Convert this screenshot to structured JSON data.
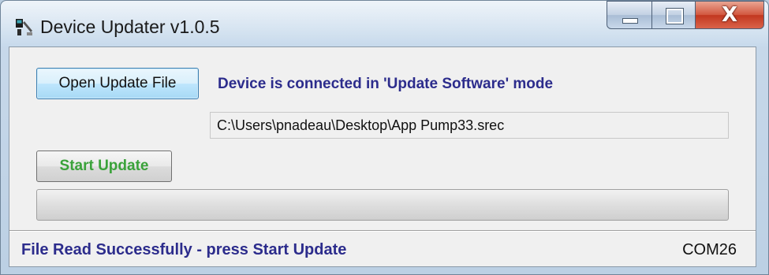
{
  "window": {
    "title": "Device Updater v1.0.5",
    "icon": "app-icon",
    "controls": {
      "minimize_icon": "minimize-icon",
      "maximize_icon": "maximize-icon",
      "close_icon": "close-icon",
      "close_glyph": "X"
    }
  },
  "main": {
    "open_button_label": "Open Update File",
    "connection_status": "Device is connected in 'Update Software' mode",
    "file_path": "C:\\Users\\pnadeau\\Desktop\\App Pump33.srec",
    "start_button_label": "Start Update",
    "progress_fraction": 0
  },
  "status_bar": {
    "message": "File Read Successfully - press Start Update",
    "port": "COM26"
  },
  "colors": {
    "status_text": "#2c2c8c",
    "start_button_text": "#3aa23a",
    "close_button": "#c2371f"
  }
}
